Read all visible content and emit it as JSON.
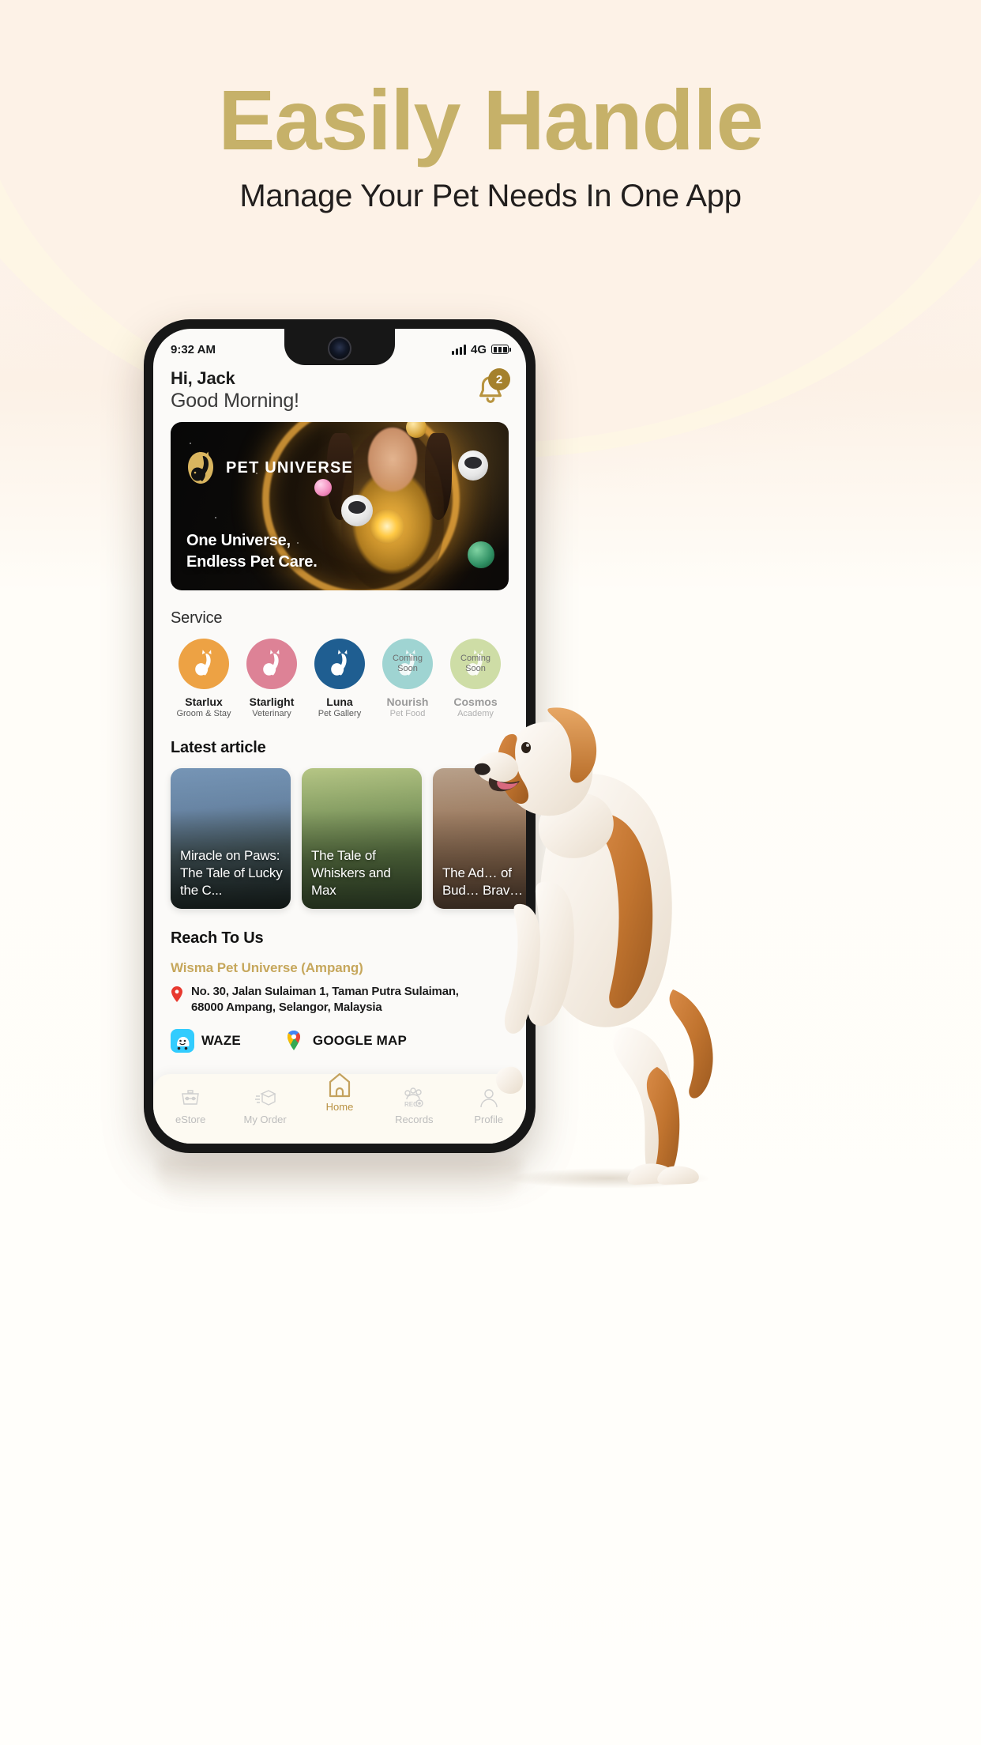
{
  "promo": {
    "title": "Easily Handle",
    "subtitle": "Manage Your Pet Needs In One App",
    "title_color": "#C6B169"
  },
  "phone": {
    "statusbar": {
      "time": "9:32 AM",
      "network": "4G",
      "signal_icon": "signal-bars-icon",
      "battery_icon": "battery-icon"
    },
    "header": {
      "greeting_name": "Hi, Jack",
      "greeting_time": "Good Morning!",
      "bell_icon": "notification-bell-icon",
      "notification_count": "2",
      "badge_color": "#A5812C"
    },
    "banner": {
      "brand": "PET UNIVERSE",
      "logo_icon": "pet-universe-logo-icon",
      "tagline_line1": "One Universe,",
      "tagline_line2": "Endless Pet Care."
    },
    "service": {
      "title": "Service",
      "items": [
        {
          "name": "Starlux",
          "desc": "Groom & Stay",
          "color": "#EDA244",
          "coming_soon": "",
          "icon": "pet-universe-logo-icon"
        },
        {
          "name": "Starlight",
          "desc": "Veterinary",
          "color": "#DD8296",
          "coming_soon": "",
          "icon": "pet-universe-logo-icon"
        },
        {
          "name": "Luna",
          "desc": "Pet Gallery",
          "color": "#1F5E91",
          "coming_soon": "",
          "icon": "pet-universe-logo-icon"
        },
        {
          "name": "Nourish",
          "desc": "Pet Food",
          "color": "#9FD4D2",
          "coming_soon": "Coming\nSoon",
          "icon": "pet-universe-logo-icon"
        },
        {
          "name": "Cosmos",
          "desc": "Academy",
          "color": "#CEDDA6",
          "coming_soon": "Coming\nSoon",
          "icon": "pet-universe-logo-icon"
        }
      ]
    },
    "articles": {
      "title": "Latest article",
      "items": [
        {
          "title": "Miracle on Paws: The Tale of Lucky the C..."
        },
        {
          "title": "The Tale of Whiskers and Max"
        },
        {
          "title": "The Ad… of Bud… Brav…"
        }
      ]
    },
    "reach": {
      "title": "Reach To Us",
      "branch": "Wisma Pet Universe (Ampang)",
      "branch_color": "#C6A75C",
      "pin_icon": "location-pin-icon",
      "address_line1": "No. 30, Jalan Sulaiman 1, Taman Putra Sulaiman,",
      "address_line2": "68000 Ampang, Selangor, Malaysia",
      "maps": [
        {
          "label": "WAZE",
          "icon": "waze-icon"
        },
        {
          "label": "GOOGLE MAP",
          "icon": "google-maps-icon"
        }
      ]
    },
    "bottomnav": {
      "items": [
        {
          "label": "eStore",
          "icon": "pet-carrier-icon",
          "active": false
        },
        {
          "label": "My Order",
          "icon": "package-icon",
          "active": false
        },
        {
          "label": "Home",
          "icon": "home-icon",
          "active": true
        },
        {
          "label": "Records",
          "icon": "paw-record-icon",
          "active": false
        },
        {
          "label": "Profile",
          "icon": "person-icon",
          "active": false
        }
      ],
      "active_color": "#B99243"
    }
  }
}
